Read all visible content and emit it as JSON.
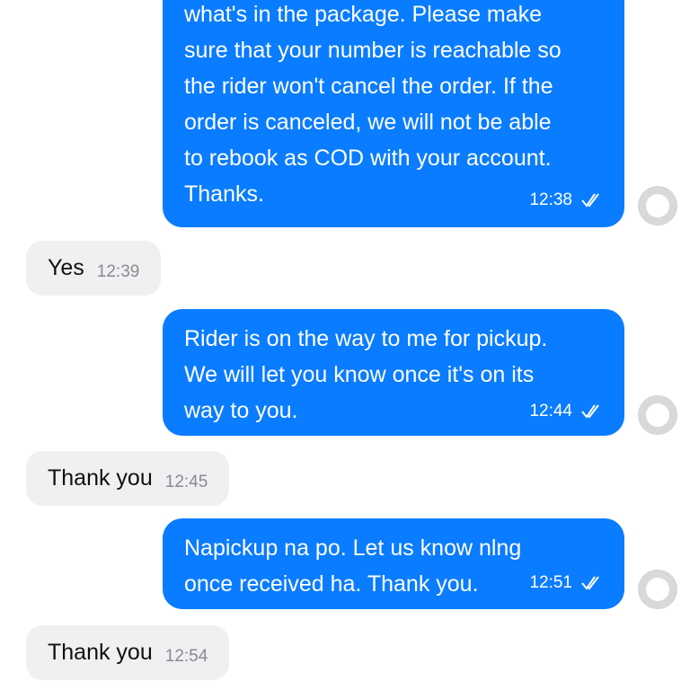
{
  "messages": [
    {
      "direction": "outgoing",
      "lines": [
        "what's in the package. Please make",
        "sure that your number is reachable so",
        "the rider won't cancel the order. If the",
        "order is canceled, we will not be able",
        "to rebook as COD with your account.",
        "Thanks."
      ],
      "time": "12:38",
      "status_icon": "double-check-icon"
    },
    {
      "direction": "incoming",
      "text": "Yes",
      "time": "12:39"
    },
    {
      "direction": "outgoing",
      "lines": [
        "Rider is on the way to me for pickup.",
        "We will let you know once it's on its",
        "way to you."
      ],
      "time": "12:44",
      "status_icon": "double-check-icon"
    },
    {
      "direction": "incoming",
      "text": "Thank you",
      "time": "12:45"
    },
    {
      "direction": "outgoing",
      "lines": [
        "Napickup na po. Let us know nlng",
        "once received ha. Thank you."
      ],
      "time": "12:51",
      "status_icon": "double-check-icon"
    },
    {
      "direction": "incoming",
      "text": "Thank you",
      "time": "12:54"
    }
  ],
  "colors": {
    "outgoing_bubble": "#0a7cff",
    "incoming_bubble": "#f0f0f3",
    "incoming_time": "#8a8a8e",
    "avatar_placeholder": "#d4d4d8"
  }
}
